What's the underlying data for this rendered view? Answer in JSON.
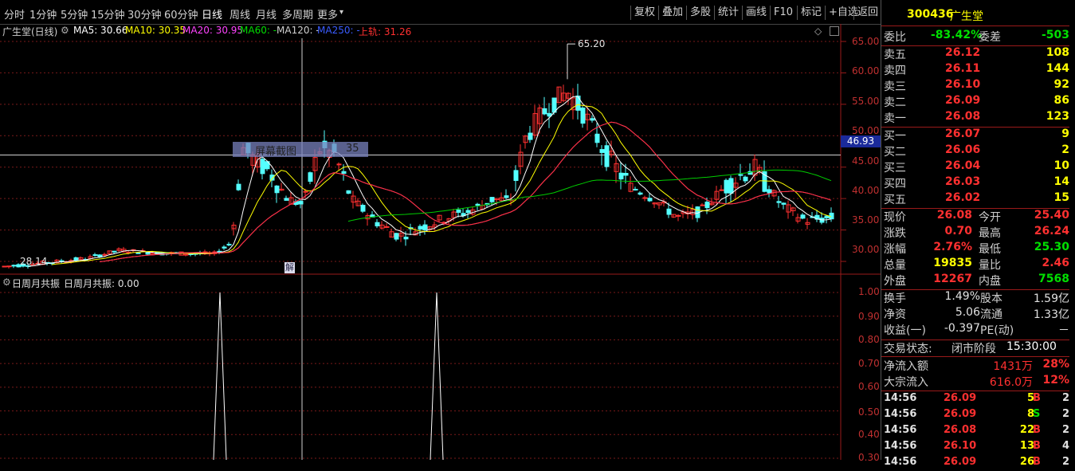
{
  "tabs": [
    "分时",
    "1分钟",
    "5分钟",
    "15分钟",
    "30分钟",
    "60分钟",
    "日线",
    "周线",
    "月线",
    "多周期",
    "更多"
  ],
  "active_tab": "日线",
  "more_arrow": "▾",
  "toolbar": [
    "复权",
    "叠加",
    "多股",
    "统计",
    "画线",
    "F10",
    "标记",
    "+自选",
    "返回"
  ],
  "chart_header": {
    "title": "广生堂(日线)",
    "ma5": "MA5: 30.66",
    "ma10": "MA10: 30.35",
    "ma20": "MA20: 30.95",
    "ma60": "MA60: -",
    "ma120": "MA120: -",
    "ma250": "MA250: -",
    "upper": "上轨: 31.26"
  },
  "price_axis": [
    "65.00",
    "60.00",
    "55.00",
    "50.00",
    "45.00",
    "40.00",
    "35.00",
    "30.00"
  ],
  "crosshair_price": "46.93",
  "high_marker": "65.20",
  "low_marker": "28.14",
  "overlay_label": "屏幕截图",
  "overlay_value": "35",
  "jie_label": "解",
  "indicator_header": {
    "name": "日周月共振",
    "value_label": "日周月共振: 0.00"
  },
  "indicator_axis": [
    "1.00",
    "0.90",
    "0.80",
    "0.70",
    "0.60",
    "0.50",
    "0.40",
    "0.30"
  ],
  "colors": {
    "bg": "#000000",
    "up": "#ff3030",
    "down": "#54ffff",
    "grid": "#7a1a1a",
    "ma5": "#ffffff",
    "ma10": "#ffff00",
    "ma20": "#ff44ff",
    "ma60": "#00cc00",
    "upper": "#ff3030"
  },
  "quote": {
    "code": "300436",
    "name": "广生堂",
    "weibi_label": "委比",
    "weibi": "-83.42%",
    "weicha_label": "委差",
    "weicha": "-503",
    "asks": [
      {
        "label": "卖五",
        "price": "26.12",
        "vol": "108"
      },
      {
        "label": "卖四",
        "price": "26.11",
        "vol": "144"
      },
      {
        "label": "卖三",
        "price": "26.10",
        "vol": "92"
      },
      {
        "label": "卖二",
        "price": "26.09",
        "vol": "86"
      },
      {
        "label": "卖一",
        "price": "26.08",
        "vol": "123"
      }
    ],
    "bids": [
      {
        "label": "买一",
        "price": "26.07",
        "vol": "9"
      },
      {
        "label": "买二",
        "price": "26.06",
        "vol": "2"
      },
      {
        "label": "买三",
        "price": "26.04",
        "vol": "10"
      },
      {
        "label": "买四",
        "price": "26.03",
        "vol": "14"
      },
      {
        "label": "买五",
        "price": "26.02",
        "vol": "15"
      }
    ],
    "stats": [
      {
        "l1": "现价",
        "v1": "26.08",
        "l2": "今开",
        "v2": "25.40"
      },
      {
        "l1": "涨跌",
        "v1": "0.70",
        "l2": "最高",
        "v2": "26.24"
      },
      {
        "l1": "涨幅",
        "v1": "2.76%",
        "l2": "最低",
        "v2": "25.30"
      },
      {
        "l1": "总量",
        "v1": "19835",
        "l2": "量比",
        "v2": "2.46"
      },
      {
        "l1": "外盘",
        "v1": "12267",
        "l2": "内盘",
        "v2": "7568"
      }
    ],
    "stats2": [
      {
        "l1": "换手",
        "v1": "1.49%",
        "l2": "股本",
        "v2": "1.59亿"
      },
      {
        "l1": "净资",
        "v1": "5.06",
        "l2": "流通",
        "v2": "1.33亿"
      },
      {
        "l1": "收益(一)",
        "v1": "-0.397",
        "l2": "PE(动)",
        "v2": "－"
      }
    ],
    "status_label": "交易状态:",
    "status_value": "闭市阶段",
    "status_time": "15:30:00",
    "flow": [
      {
        "label": "净流入额",
        "value": "1431万",
        "pct": "28%"
      },
      {
        "label": "大宗流入",
        "value": "616.0万",
        "pct": "12%"
      }
    ],
    "ticks": [
      {
        "time": "14:56",
        "price": "26.09",
        "vol": "5",
        "side": "B",
        "n": "2"
      },
      {
        "time": "14:56",
        "price": "26.09",
        "vol": "8",
        "side": "S",
        "n": "2"
      },
      {
        "time": "14:56",
        "price": "26.08",
        "vol": "22",
        "side": "B",
        "n": "2"
      },
      {
        "time": "14:56",
        "price": "26.10",
        "vol": "13",
        "side": "B",
        "n": "4"
      },
      {
        "time": "14:56",
        "price": "26.09",
        "vol": "26",
        "side": "B",
        "n": "2"
      }
    ]
  }
}
